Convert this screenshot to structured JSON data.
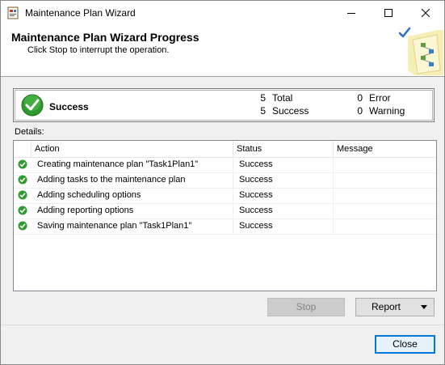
{
  "window": {
    "title": "Maintenance Plan Wizard"
  },
  "header": {
    "title": "Maintenance Plan Wizard Progress",
    "subtitle": "Click Stop to interrupt the operation."
  },
  "summary": {
    "status": "Success",
    "total_count": "5",
    "total_label": "Total",
    "success_count": "5",
    "success_label": "Success",
    "error_count": "0",
    "error_label": "Error",
    "warning_count": "0",
    "warning_label": "Warning"
  },
  "details_label": "Details:",
  "grid": {
    "columns": [
      "Action",
      "Status",
      "Message"
    ],
    "rows": [
      {
        "action": "Creating maintenance plan \"Task1Plan1\"",
        "status": "Success",
        "message": ""
      },
      {
        "action": "Adding tasks to the maintenance plan",
        "status": "Success",
        "message": ""
      },
      {
        "action": "Adding scheduling options",
        "status": "Success",
        "message": ""
      },
      {
        "action": "Adding reporting options",
        "status": "Success",
        "message": ""
      },
      {
        "action": "Saving maintenance plan \"Task1Plan1\"",
        "status": "Success",
        "message": ""
      }
    ]
  },
  "buttons": {
    "stop": "Stop",
    "report": "Report",
    "close": "Close"
  },
  "colors": {
    "success_green": "#2e9b2e",
    "accent_blue": "#0078d7"
  }
}
